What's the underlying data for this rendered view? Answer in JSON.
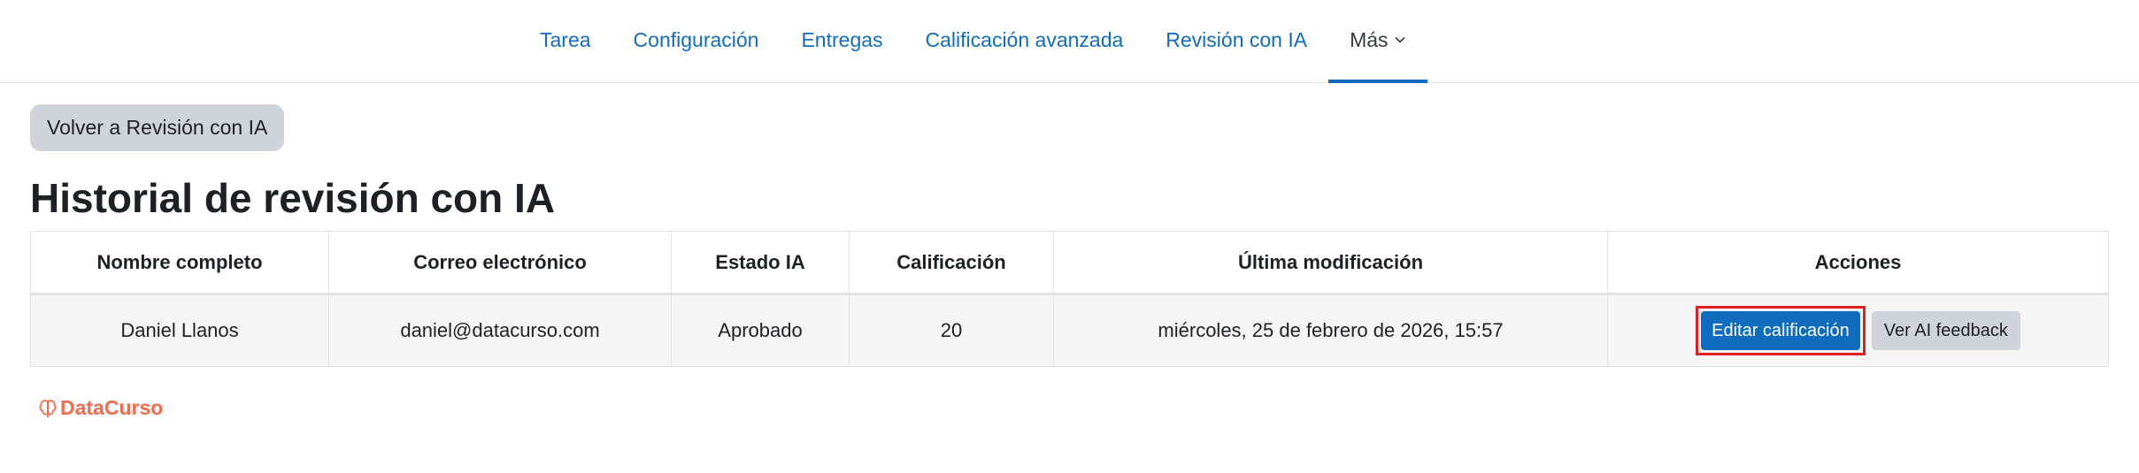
{
  "nav": {
    "items": [
      {
        "label": "Tarea"
      },
      {
        "label": "Configuración"
      },
      {
        "label": "Entregas"
      },
      {
        "label": "Calificación avanzada"
      },
      {
        "label": "Revisión con IA"
      },
      {
        "label": "Más"
      }
    ],
    "active_color": "#0f6cbf"
  },
  "back_button": {
    "label": "Volver a Revisión con IA"
  },
  "page": {
    "title": "Historial de revisión con IA"
  },
  "table": {
    "headers": [
      "Nombre completo",
      "Correo electrónico",
      "Estado IA",
      "Calificación",
      "Última modificación",
      "Acciones"
    ],
    "rows": [
      {
        "name": "Daniel Llanos",
        "email": "daniel@datacurso.com",
        "status": "Aprobado",
        "grade": "20",
        "modified": "miércoles, 25 de febrero de 2026, 15:57",
        "edit_label": "Editar calificación",
        "view_label": "Ver AI feedback"
      }
    ]
  },
  "logo": {
    "text": "DataCurso",
    "color": "#f26b4f"
  }
}
